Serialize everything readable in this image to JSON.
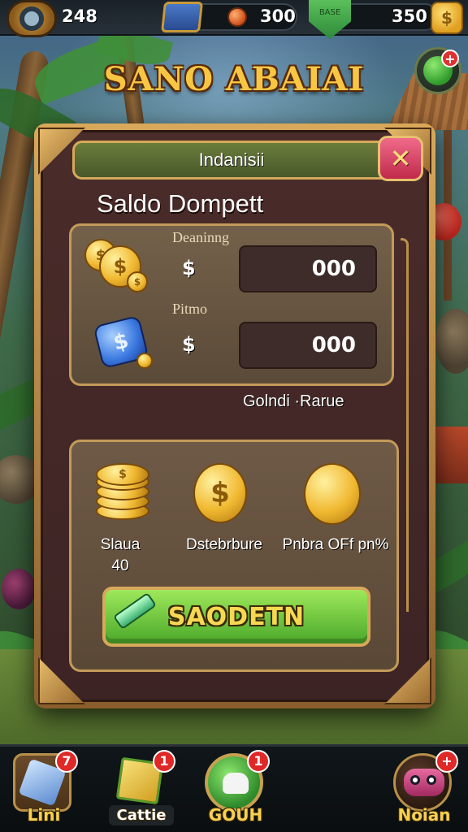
{
  "top_bar": {
    "player_level": "248",
    "gem_count": "300",
    "coin_count": "350"
  },
  "game_title": "SANO ABAIAI",
  "modal": {
    "header": "Indanisii",
    "close_label": "✕",
    "wallet_title": "Saldo Dompett",
    "balances": [
      {
        "label": "Deaninng",
        "currency": "$",
        "value": "000",
        "icon": "gold-coins-icon"
      },
      {
        "label": "Pitmo",
        "currency": "$",
        "value": "000",
        "icon": "blue-coin-icon"
      }
    ],
    "note": "Golndi ·Rarue",
    "shop_items": [
      {
        "label": "Slaua\n40",
        "icon": "coin-stack-icon"
      },
      {
        "label": "Dstebrbure",
        "icon": "gold-coin-icon"
      },
      {
        "label": "Pnbra OFf pn%",
        "icon": "gold-orb-icon"
      }
    ],
    "buy_button": "SAODETN"
  },
  "bottom_nav": [
    {
      "label": "Lini",
      "badge": "7",
      "icon": "crystal-icon"
    },
    {
      "label": "Cattie",
      "badge": "1",
      "icon": "gift-box-icon"
    },
    {
      "label": "GOUH",
      "badge": "1",
      "icon": "hand-icon"
    },
    {
      "label": "Noian",
      "badge": "+",
      "icon": "monster-icon"
    }
  ],
  "colors": {
    "title_gold": "#f7c744",
    "button_green": "#4aa82a",
    "badge_red": "#e02828"
  }
}
